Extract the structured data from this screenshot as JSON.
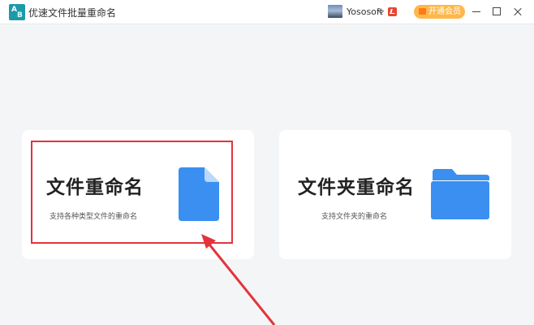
{
  "window": {
    "title": "优速文件批量重命名",
    "username": "Yososoft",
    "vip_label": "开通会员"
  },
  "icons": {
    "app_logo": "app-logo-icon",
    "avatar": "user-avatar",
    "dropdown": "chevron-down-icon",
    "brand": "brand-badge-icon",
    "vip": "crown-icon",
    "minimize": "minimize-icon",
    "maximize": "maximize-icon",
    "close": "close-icon",
    "file": "file-icon",
    "folder": "folder-icon"
  },
  "cards": [
    {
      "title": "文件重命名",
      "subtitle": "支持各种类型文件的重命名"
    },
    {
      "title": "文件夹重命名",
      "subtitle": "支持文件夹的重命名"
    }
  ],
  "colors": {
    "accent": "#3a8ff0",
    "highlight": "#e3333b",
    "vip": "#ffb74a"
  }
}
